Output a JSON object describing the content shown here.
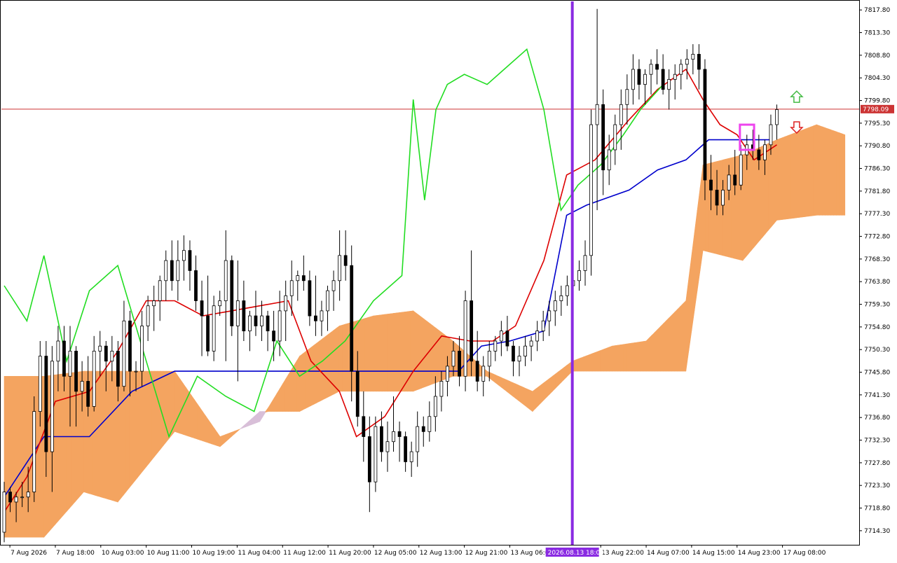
{
  "chart_data": {
    "type": "candlestick",
    "ylim": [
      7711.5,
      7819.5
    ],
    "price_axis_labels": [
      "7817.80",
      "7813.30",
      "7808.80",
      "7804.30",
      "7799.80",
      "7795.30",
      "7790.80",
      "7786.30",
      "7781.80",
      "7777.30",
      "7772.80",
      "7768.30",
      "7763.80",
      "7759.30",
      "7754.80",
      "7750.30",
      "7745.80",
      "7741.30",
      "7736.80",
      "7732.30",
      "7727.80",
      "7723.30",
      "7718.80",
      "7714.30"
    ],
    "price_axis_values": [
      7817.8,
      7813.3,
      7808.8,
      7804.3,
      7799.8,
      7795.3,
      7790.8,
      7786.3,
      7781.8,
      7777.3,
      7772.8,
      7768.3,
      7763.8,
      7759.3,
      7754.8,
      7750.3,
      7745.8,
      7741.3,
      7736.8,
      7732.3,
      7727.8,
      7723.3,
      7718.8,
      7714.3
    ],
    "time_axis_labels": [
      "7 Aug 2026",
      "7 Aug 18:00",
      "10 Aug 03:00",
      "10 Aug 11:00",
      "10 Aug 19:00",
      "11 Aug 04:00",
      "11 Aug 12:00",
      "11 Aug 20:00",
      "12 Aug 05:00",
      "12 Aug 13:00",
      "12 Aug 21:00",
      "13 Aug 06:00",
      "13 Aug 22:00",
      "14 Aug 07:00",
      "14 Aug 15:00",
      "14 Aug 23:00",
      "17 Aug 08:00"
    ],
    "time_axis_bar_index": [
      2,
      18,
      34,
      50,
      66,
      82,
      98,
      114,
      130,
      146,
      162,
      178,
      210,
      226,
      242,
      258,
      274
    ],
    "current_price": 7798.09,
    "current_price_label": "7798.09",
    "marker_label": "2026.08.13 18:00",
    "marker_bar_index": 200,
    "candles": [
      [
        7714,
        7724,
        7712,
        7722
      ],
      [
        7722,
        7723,
        7718,
        7720
      ],
      [
        7720,
        7722,
        7716,
        7721
      ],
      [
        7721,
        7724,
        7719,
        7721
      ],
      [
        7721,
        7727,
        7718,
        7722
      ],
      [
        7722,
        7741,
        7720,
        7738
      ],
      [
        7738,
        7752,
        7735,
        7749
      ],
      [
        7749,
        7752,
        7725,
        7730
      ],
      [
        7730,
        7751,
        7722,
        7748
      ],
      [
        7748,
        7755,
        7742,
        7752
      ],
      [
        7752,
        7755,
        7742,
        7745
      ],
      [
        7745,
        7755,
        7735,
        7750
      ],
      [
        7750,
        7751,
        7735,
        7742
      ],
      [
        7742,
        7748,
        7738,
        7744
      ],
      [
        7744,
        7749,
        7737,
        7739
      ],
      [
        7739,
        7753,
        7738,
        7750
      ],
      [
        7750,
        7754,
        7745,
        7751
      ],
      [
        7751,
        7752,
        7742,
        7748
      ],
      [
        7748,
        7753,
        7744,
        7750
      ],
      [
        7750,
        7752,
        7740,
        7743
      ],
      [
        7743,
        7760,
        7742,
        7756
      ],
      [
        7756,
        7758,
        7741,
        7746
      ],
      [
        7746,
        7748,
        7742,
        7746
      ],
      [
        7746,
        7758,
        7743,
        7755
      ],
      [
        7755,
        7761,
        7752,
        7759
      ],
      [
        7759,
        7763,
        7754,
        7760
      ],
      [
        7760,
        7765,
        7756,
        7764
      ],
      [
        7764,
        7770,
        7760,
        7768
      ],
      [
        7768,
        7772,
        7762,
        7764
      ],
      [
        7764,
        7772,
        7760,
        7768
      ],
      [
        7768,
        7773,
        7764,
        7770
      ],
      [
        7770,
        7772,
        7762,
        7766
      ],
      [
        7766,
        7769,
        7758,
        7760
      ],
      [
        7760,
        7764,
        7749,
        7757
      ],
      [
        7757,
        7765,
        7749,
        7750
      ],
      [
        7750,
        7761,
        7748,
        7759
      ],
      [
        7759,
        7762,
        7757,
        7760
      ],
      [
        7760,
        7774,
        7748,
        7768
      ],
      [
        7768,
        7769,
        7753,
        7755
      ],
      [
        7755,
        7768,
        7744,
        7760
      ],
      [
        7760,
        7764,
        7752,
        7754
      ],
      [
        7754,
        7758,
        7750,
        7757
      ],
      [
        7757,
        7762,
        7753,
        7755
      ],
      [
        7755,
        7760,
        7752,
        7757
      ],
      [
        7757,
        7758,
        7750,
        7754
      ],
      [
        7754,
        7758,
        7748,
        7752
      ],
      [
        7752,
        7762,
        7749,
        7758
      ],
      [
        7758,
        7764,
        7752,
        7761
      ],
      [
        7761,
        7768,
        7757,
        7764
      ],
      [
        7764,
        7766,
        7760,
        7765
      ],
      [
        7765,
        7769,
        7762,
        7764
      ],
      [
        7764,
        7766,
        7755,
        7757
      ],
      [
        7757,
        7765,
        7753,
        7756
      ],
      [
        7756,
        7760,
        7753,
        7758
      ],
      [
        7758,
        7763,
        7754,
        7762
      ],
      [
        7762,
        7766,
        7758,
        7764
      ],
      [
        7764,
        7774,
        7760,
        7769
      ],
      [
        7769,
        7774,
        7764,
        7767
      ],
      [
        7767,
        7771,
        7740,
        7746
      ],
      [
        7746,
        7750,
        7735,
        7737
      ],
      [
        7737,
        7742,
        7728,
        7733
      ],
      [
        7733,
        7737,
        7718,
        7724
      ],
      [
        7724,
        7737,
        7722,
        7735
      ],
      [
        7735,
        7738,
        7728,
        7730
      ],
      [
        7730,
        7736,
        7726,
        7732
      ],
      [
        7732,
        7741,
        7730,
        7734
      ],
      [
        7734,
        7736,
        7728,
        7733
      ],
      [
        7733,
        7734,
        7726,
        7728
      ],
      [
        7728,
        7732,
        7725,
        7730
      ],
      [
        7730,
        7738,
        7727,
        7735
      ],
      [
        7735,
        7737,
        7731,
        7734
      ],
      [
        7734,
        7740,
        7732,
        7737
      ],
      [
        7737,
        7745,
        7734,
        7741
      ],
      [
        7741,
        7746,
        7738,
        7744
      ],
      [
        7744,
        7749,
        7741,
        7747
      ],
      [
        7747,
        7752,
        7745,
        7750
      ],
      [
        7750,
        7753,
        7743,
        7745
      ],
      [
        7745,
        7762,
        7742,
        7760
      ],
      [
        7760,
        7770,
        7745,
        7748
      ],
      [
        7748,
        7754,
        7742,
        7744
      ],
      [
        7744,
        7749,
        7741,
        7747
      ],
      [
        7747,
        7752,
        7744,
        7750
      ],
      [
        7750,
        7753,
        7748,
        7752
      ],
      [
        7752,
        7756,
        7749,
        7754
      ],
      [
        7754,
        7757,
        7750,
        7751
      ],
      [
        7751,
        7752,
        7745,
        7748
      ],
      [
        7748,
        7751,
        7745,
        7749
      ],
      [
        7749,
        7753,
        7747,
        7751
      ],
      [
        7751,
        7753,
        7748,
        7752
      ],
      [
        7752,
        7756,
        7750,
        7754
      ],
      [
        7754,
        7758,
        7752,
        7756
      ],
      [
        7756,
        7760,
        7753,
        7758
      ],
      [
        7758,
        7762,
        7755,
        7760
      ],
      [
        7760,
        7763,
        7757,
        7761
      ],
      [
        7761,
        7765,
        7759,
        7763
      ],
      [
        7763,
        7766,
        7760,
        7764
      ],
      [
        7764,
        7768,
        7762,
        7766
      ],
      [
        7766,
        7772,
        7763,
        7769
      ],
      [
        7769,
        7798,
        7765,
        7795
      ],
      [
        7795,
        7818,
        7778,
        7799
      ],
      [
        7799,
        7802,
        7781,
        7786
      ],
      [
        7786,
        7793,
        7783,
        7790
      ],
      [
        7790,
        7797,
        7787,
        7795
      ],
      [
        7795,
        7802,
        7790,
        7799
      ],
      [
        7799,
        7805,
        7795,
        7802
      ],
      [
        7802,
        7809,
        7799,
        7806
      ],
      [
        7806,
        7808,
        7800,
        7803
      ],
      [
        7803,
        7806,
        7799,
        7805
      ],
      [
        7805,
        7808,
        7801,
        7807
      ],
      [
        7807,
        7810,
        7803,
        7806
      ],
      [
        7806,
        7809,
        7801,
        7802
      ],
      [
        7802,
        7806,
        7798,
        7804
      ],
      [
        7804,
        7807,
        7800,
        7805
      ],
      [
        7805,
        7808,
        7802,
        7807
      ],
      [
        7807,
        7810,
        7804,
        7808
      ],
      [
        7808,
        7811,
        7805,
        7809
      ],
      [
        7809,
        7811,
        7802,
        7806
      ],
      [
        7806,
        7808,
        7780,
        7784
      ],
      [
        7784,
        7789,
        7778,
        7782
      ],
      [
        7782,
        7786,
        7777,
        7779
      ],
      [
        7779,
        7784,
        7777,
        7782
      ],
      [
        7782,
        7787,
        7780,
        7785
      ],
      [
        7785,
        7790,
        7781,
        7783
      ],
      [
        7783,
        7791,
        7782,
        7789
      ],
      [
        7789,
        7793,
        7786,
        7791
      ],
      [
        7791,
        7794,
        7788,
        7790
      ],
      [
        7790,
        7793,
        7786,
        7788
      ],
      [
        7788,
        7792,
        7785,
        7791
      ],
      [
        7791,
        7797,
        7789,
        7795
      ],
      [
        7795,
        7799,
        7792,
        7798
      ]
    ],
    "candle_bar_span": [
      0,
      272
    ],
    "kijun_points": [
      [
        0,
        7721
      ],
      [
        14,
        7733
      ],
      [
        30,
        7733
      ],
      [
        45,
        7742
      ],
      [
        60,
        7746
      ],
      [
        90,
        7746
      ],
      [
        120,
        7746
      ],
      [
        140,
        7746
      ],
      [
        160,
        7746
      ],
      [
        168,
        7751
      ],
      [
        178,
        7752
      ],
      [
        190,
        7754
      ],
      [
        198,
        7777
      ],
      [
        205,
        7779
      ],
      [
        220,
        7782
      ],
      [
        230,
        7786
      ],
      [
        240,
        7788
      ],
      [
        248,
        7792
      ],
      [
        270,
        7792
      ]
    ],
    "tenkan_points": [
      [
        0,
        7718
      ],
      [
        8,
        7725
      ],
      [
        18,
        7740
      ],
      [
        30,
        7742
      ],
      [
        40,
        7750
      ],
      [
        50,
        7760
      ],
      [
        60,
        7760
      ],
      [
        70,
        7757
      ],
      [
        80,
        7758
      ],
      [
        90,
        7759
      ],
      [
        100,
        7760
      ],
      [
        108,
        7748
      ],
      [
        118,
        7742
      ],
      [
        124,
        7733
      ],
      [
        134,
        7737
      ],
      [
        144,
        7746
      ],
      [
        154,
        7753
      ],
      [
        164,
        7752
      ],
      [
        172,
        7752
      ],
      [
        180,
        7755
      ],
      [
        190,
        7768
      ],
      [
        198,
        7785
      ],
      [
        208,
        7788
      ],
      [
        220,
        7796
      ],
      [
        230,
        7802
      ],
      [
        240,
        7806
      ],
      [
        246,
        7800
      ],
      [
        252,
        7795
      ],
      [
        258,
        7793
      ],
      [
        264,
        7788
      ],
      [
        272,
        7791
      ]
    ],
    "chikou_points": [
      [
        0,
        7763
      ],
      [
        8,
        7756
      ],
      [
        14,
        7769
      ],
      [
        22,
        7748
      ],
      [
        30,
        7762
      ],
      [
        40,
        7767
      ],
      [
        50,
        7748
      ],
      [
        58,
        7733
      ],
      [
        68,
        7745
      ],
      [
        78,
        7741
      ],
      [
        88,
        7738
      ],
      [
        96,
        7752
      ],
      [
        104,
        7745
      ],
      [
        112,
        7748
      ],
      [
        120,
        7752
      ],
      [
        130,
        7760
      ],
      [
        140,
        7765
      ],
      [
        144,
        7800
      ],
      [
        148,
        7780
      ],
      [
        152,
        7798
      ],
      [
        156,
        7803
      ],
      [
        162,
        7805
      ],
      [
        170,
        7803
      ],
      [
        176,
        7806
      ],
      [
        184,
        7810
      ],
      [
        190,
        7798
      ],
      [
        196,
        7778
      ],
      [
        202,
        7783
      ],
      [
        210,
        7787
      ],
      [
        218,
        7793
      ],
      [
        224,
        7798
      ],
      [
        232,
        7803
      ]
    ],
    "cloud_upper_points": [
      [
        0,
        7745
      ],
      [
        14,
        7745
      ],
      [
        28,
        7746
      ],
      [
        40,
        7746
      ],
      [
        60,
        7746
      ],
      [
        76,
        7733
      ],
      [
        90,
        7736
      ],
      [
        104,
        7749
      ],
      [
        118,
        7755
      ],
      [
        130,
        7757
      ],
      [
        144,
        7758
      ],
      [
        158,
        7752
      ],
      [
        170,
        7746
      ],
      [
        186,
        7742
      ],
      [
        200,
        7748
      ],
      [
        214,
        7751
      ],
      [
        226,
        7752
      ],
      [
        240,
        7760
      ],
      [
        246,
        7787
      ],
      [
        260,
        7789
      ],
      [
        272,
        7792
      ],
      [
        286,
        7795
      ],
      [
        296,
        7793
      ]
    ],
    "cloud_lower_points": [
      [
        0,
        7713
      ],
      [
        14,
        7713
      ],
      [
        28,
        7722
      ],
      [
        40,
        7720
      ],
      [
        60,
        7734
      ],
      [
        76,
        7731
      ],
      [
        90,
        7738
      ],
      [
        104,
        7738
      ],
      [
        118,
        7742
      ],
      [
        130,
        7742
      ],
      [
        144,
        7742
      ],
      [
        158,
        7745
      ],
      [
        170,
        7745
      ],
      [
        186,
        7738
      ],
      [
        200,
        7746
      ],
      [
        214,
        7746
      ],
      [
        226,
        7746
      ],
      [
        240,
        7746
      ],
      [
        246,
        7770
      ],
      [
        260,
        7768
      ],
      [
        272,
        7776
      ],
      [
        286,
        7777
      ],
      [
        296,
        7777
      ]
    ],
    "colors": {
      "bull_cloud": "#f4a460",
      "bear_cloud": "#d8bfd8",
      "tenkan": "#dd0000",
      "kijun": "#0000cc",
      "chikou": "#22dd22",
      "senkou_span": "#ff69b4",
      "marker": "#8a2be2",
      "price_line": "#cc3333",
      "highlight_box": "#ee44ee",
      "up_arrow": "#44bb44",
      "down_arrow": "#dd2222"
    },
    "annotations": [
      {
        "type": "highlight-box",
        "bar_range": [
          259,
          264
        ],
        "price_range": [
          7790,
          7795
        ]
      },
      {
        "type": "up-arrow",
        "bar_index": 279,
        "price": 7800
      },
      {
        "type": "down-arrow",
        "bar_index": 279,
        "price": 7795
      }
    ]
  }
}
